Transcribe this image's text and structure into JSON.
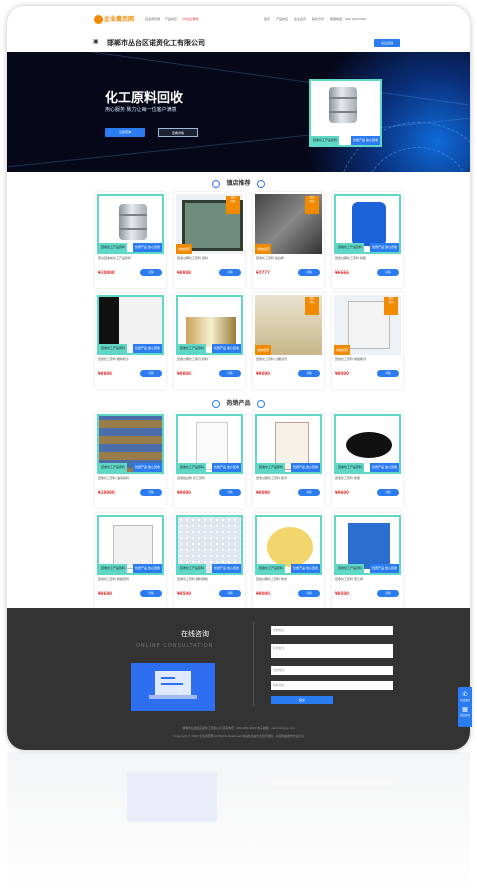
{
  "topbar": {
    "logo": "企业黄页网",
    "links": [
      "企业黄页网",
      "产品供应",
      "VIP企业服务"
    ],
    "nav": [
      "首页",
      "产品供应",
      "企业资讯",
      "联系方式",
      "客服电话：400-000-0000"
    ]
  },
  "company": {
    "name": "邯郸市丛台区诺资化工有限公司",
    "follow_label": "关注店铺"
  },
  "banner": {
    "title": "化工原料回收",
    "subtitle": "用心服务 致力让每一位客户满意",
    "btn_primary": "立即咨询",
    "btn_secondary": "查看详情",
    "prod_tag": "回收化工产品原料",
    "prod_tag2": "优质产品 放心回收"
  },
  "sections": {
    "recommended": "镇店推荐",
    "hot": "热销产品"
  },
  "recommended": [
    {
      "title": "邢台回收氟化工产品原料",
      "price": "¥10000",
      "btn": "详情",
      "img": "barrel",
      "badge": "teal"
    },
    {
      "title": "回收过期化工原料 染料",
      "price": "¥8888",
      "btn": "详情",
      "img": "paint",
      "badge": "orange"
    },
    {
      "title": "回收化工原料 钛白粉",
      "price": "¥7777",
      "btn": "详情",
      "img": "bags",
      "badge": "orange"
    },
    {
      "title": "回收过期化工原料 树脂",
      "price": "¥6666",
      "btn": "详情",
      "img": "bluedrum",
      "badge": "teal"
    },
    {
      "title": "回收化工原料 塑料粒子",
      "price": "¥8888",
      "btn": "详情",
      "img": "white",
      "badge": "teal"
    },
    {
      "title": "回收过期化工助剂 颜料",
      "price": "¥8888",
      "btn": "详情",
      "img": "bottles",
      "badge": "teal"
    },
    {
      "title": "回收化工原料 过期试剂",
      "price": "¥9000",
      "btn": "详情",
      "img": "cans",
      "badge": "orange"
    },
    {
      "title": "回收化工原料 橡胶助剂",
      "price": "¥8000",
      "btn": "详情",
      "img": "sack",
      "badge": "orange"
    }
  ],
  "hot": [
    {
      "title": "回收化工原料 油漆染料",
      "price": "¥10000",
      "btn": "详情",
      "img": "shelf"
    },
    {
      "title": "回收钛白粉 化工原料",
      "price": "¥9000",
      "btn": "详情",
      "img": "tio2"
    },
    {
      "title": "回收过期化工原料 助剂",
      "price": "¥8000",
      "btn": "详情",
      "img": "bag2"
    },
    {
      "title": "回收化工原料 炭黑",
      "price": "¥9600",
      "btn": "详情",
      "img": "black"
    },
    {
      "title": "回收化工原料 橡胶原料",
      "price": "¥8600",
      "btn": "详情",
      "img": "sack2"
    },
    {
      "title": "回收化工原料 塑料颗粒",
      "price": "¥9500",
      "btn": "详情",
      "img": "pellets"
    },
    {
      "title": "回收过期化工原料 粉末",
      "price": "¥9000",
      "btn": "详情",
      "img": "powder"
    },
    {
      "title": "回收化工原料 聚乙烯",
      "price": "¥8500",
      "btn": "详情",
      "img": "pe"
    }
  ],
  "footer": {
    "consult_title": "在线咨询",
    "consult_en": "ONLINE CONSULTATION",
    "fields": [
      "您的姓名",
      "您的留言",
      "您的电话",
      "联系地址"
    ],
    "submit": "提交",
    "copy1": "邯郸市丛台区诺资化工有限公司   联系电话：400-000-0000   电子邮箱：service@qq.com",
    "copy2": "Copyright © 2020 企业黄页网 All Rights Reserved  本站信息由企业自行提供，真实性由发布企业负责"
  },
  "side": {
    "phone": "电话咨询",
    "wechat": "微信咨询"
  },
  "colors": {
    "accent": "#2b7cf0",
    "orange": "#f08a00",
    "teal": "#5fd8c8",
    "price": "#e33333",
    "footer": "#333333"
  }
}
